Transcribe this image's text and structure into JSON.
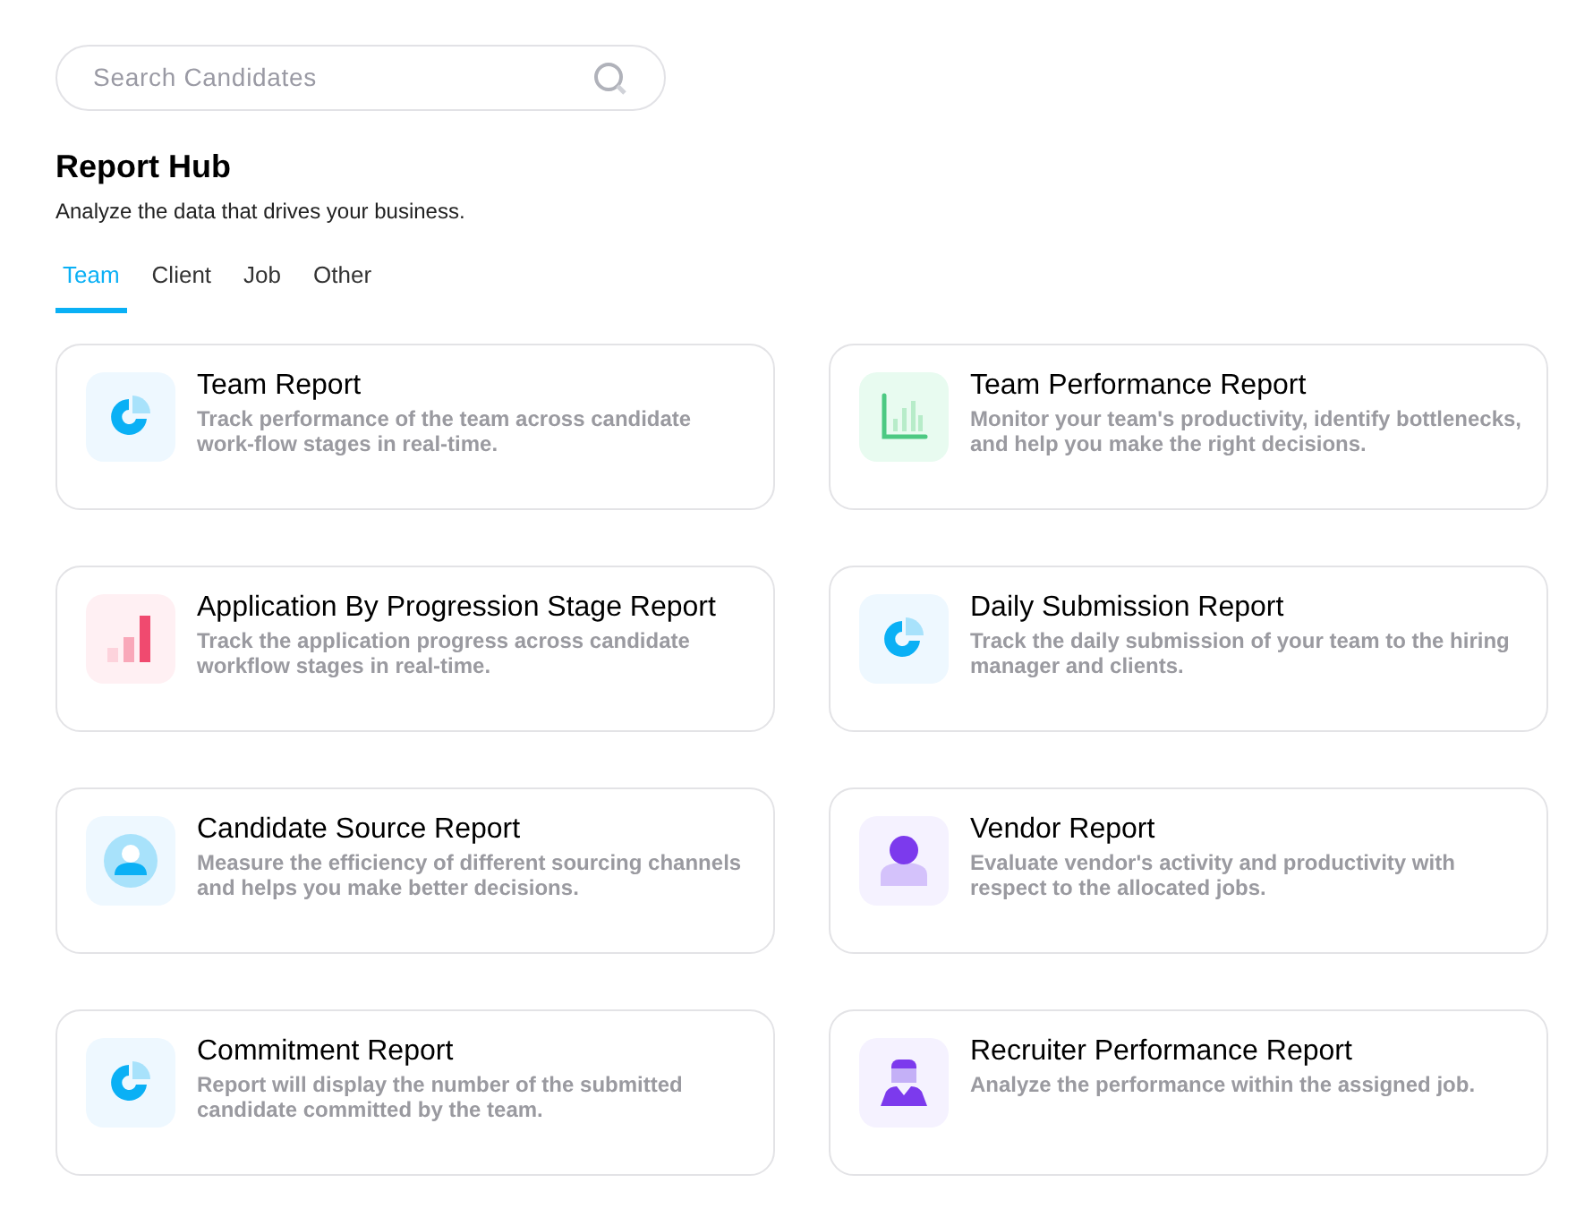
{
  "search": {
    "placeholder": "Search Candidates"
  },
  "header": {
    "title": "Report Hub",
    "subtitle": "Analyze the data that drives your business."
  },
  "tabs": [
    {
      "label": "Team",
      "selected": true
    },
    {
      "label": "Client",
      "selected": false
    },
    {
      "label": "Job",
      "selected": false
    },
    {
      "label": "Other",
      "selected": false
    }
  ],
  "reports": [
    {
      "kind": "pie",
      "title": "Team Report",
      "description": "Track performance of the team across candidate work-flow stages in real-time."
    },
    {
      "kind": "chart",
      "title": "Team Performance Report",
      "description": "Monitor your team's productivity, identify bottlenecks, and help you make the right decisions."
    },
    {
      "kind": "bars",
      "title": "Application By Progression Stage Report",
      "description": "Track the application progress across candidate workflow stages in real-time."
    },
    {
      "kind": "pie",
      "title": "Daily Submission Report",
      "description": "Track the daily submission of your team to the hiring manager and clients."
    },
    {
      "kind": "source",
      "title": "Candidate Source Report",
      "description": "Measure the efficiency of different sourcing channels and helps you make better decisions."
    },
    {
      "kind": "vendor",
      "title": "Vendor Report",
      "description": "Evaluate vendor's activity and productivity with respect to the allocated jobs."
    },
    {
      "kind": "pie",
      "title": "Commitment Report",
      "description": "Report will display the number of the submitted candidate committed by the team."
    },
    {
      "kind": "recruiter",
      "title": "Recruiter Performance Report",
      "description": "Analyze the performance within the assigned job."
    }
  ]
}
